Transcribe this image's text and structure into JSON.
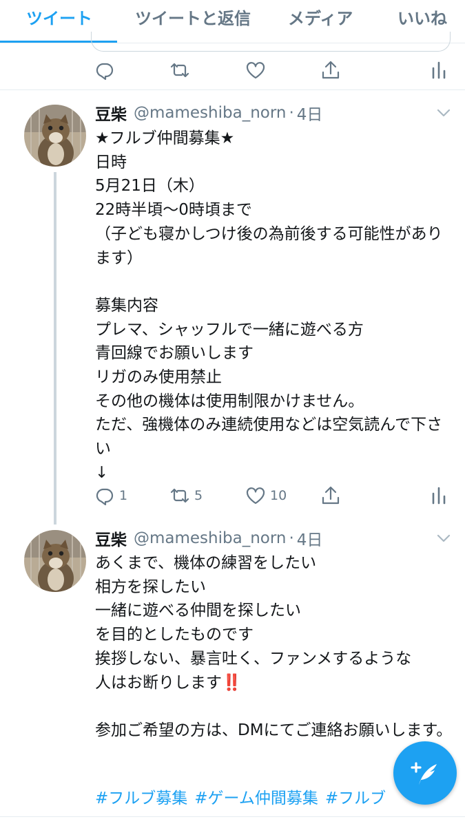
{
  "tabs": [
    {
      "label": "ツイート",
      "active": true
    },
    {
      "label": "ツイートと返信",
      "active": false
    },
    {
      "label": "メディア",
      "active": false
    },
    {
      "label": "いいね",
      "active": false
    }
  ],
  "colors": {
    "accent": "#1da1f2",
    "muted": "#657786",
    "divider": "#e6ecf0"
  },
  "tweets": [
    {
      "name": "豆柴",
      "handle": "@mameshiba_norn",
      "dot": "·",
      "time": "4日",
      "body": "★フルブ仲間募集★\n日時\n5月21日（木）\n22時半頃〜0時頃まで\n（子ども寝かしつけ後の為前後する可能性があります）\n\n募集内容\nプレマ、シャッフルで一緒に遊べる方\n青回線でお願いします\nリガのみ使用禁止\nその他の機体は使用制限かけません。\nただ、強機体のみ連続使用などは空気読んで下さい\n↓",
      "reply_count": "1",
      "retweet_count": "5",
      "like_count": "10"
    },
    {
      "name": "豆柴",
      "handle": "@mameshiba_norn",
      "dot": "·",
      "time": "4日",
      "body_lines": [
        "あくまで、機体の練習をしたい",
        "相方を探したい",
        "一緒に遊べる仲間を探したい",
        "を目的としたものです",
        "挨拶しない、暴言吐く、ファンメするような",
        "人はお断りします"
      ],
      "emoji": "‼️",
      "body_after": "参加ご希望の方は、DMにてご連絡お願いします。",
      "hashtags": [
        "#フルブ募集",
        "#ゲーム仲間募集",
        "#フルブ"
      ]
    }
  ],
  "icons": {
    "reply": "reply-icon",
    "retweet": "retweet-icon",
    "like": "heart-icon",
    "share": "share-icon",
    "analytics": "analytics-icon",
    "compose": "compose-tweet-icon"
  }
}
